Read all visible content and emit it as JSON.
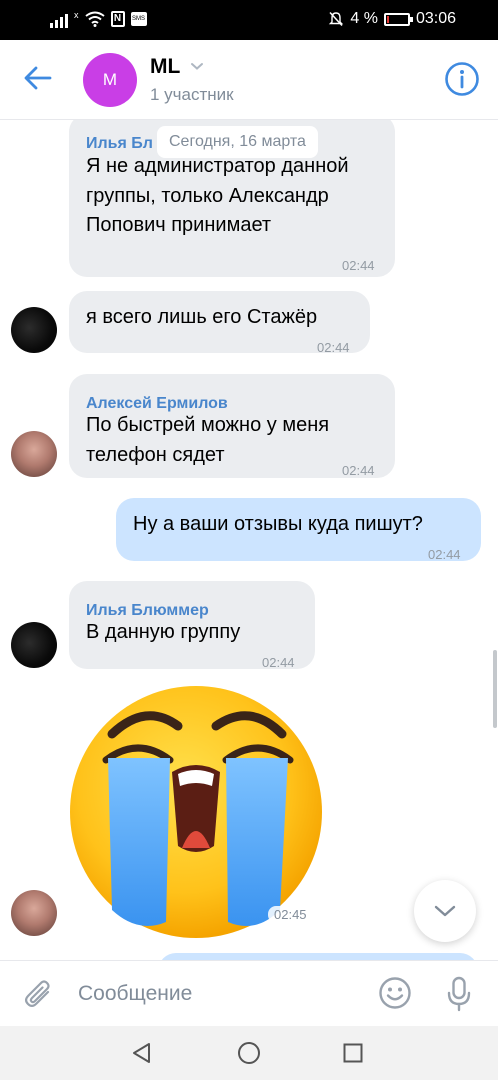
{
  "status_bar": {
    "signal_mark": "x",
    "nfc_label": "N",
    "sms_label": "SMS",
    "battery_percent": "4 %",
    "time": "03:06"
  },
  "header": {
    "avatar_letter": "M",
    "avatar_color": "#c93ee6",
    "title": "ML",
    "subtitle": "1 участник"
  },
  "chat": {
    "date_separator": "Сегодня, 16 марта",
    "messages": [
      {
        "sender": "Илья Бл",
        "text": "Я не администратор данной группы, только Александр Попович принимает",
        "time": "02:44",
        "outgoing": false
      },
      {
        "sender": "",
        "text": "я всего лишь его Стажёр",
        "time": "02:44",
        "outgoing": false
      },
      {
        "sender": "Алексей Ермилов",
        "text": "По быстрей можно у меня телефон сядет",
        "time": "02:44",
        "outgoing": false
      },
      {
        "sender": "",
        "text": "Ну а ваши отзывы куда пишут?",
        "time": "02:44",
        "outgoing": true
      },
      {
        "sender": "Илья Блюммер",
        "text": "В данную группу",
        "time": "02:44",
        "outgoing": false
      },
      {
        "sender": "",
        "sticker": "crying-face-sticker",
        "time": "02:45",
        "outgoing": false
      }
    ]
  },
  "input": {
    "placeholder": "Сообщение"
  },
  "colors": {
    "accent": "#3f8ae0",
    "incoming_bubble": "#ebedf0",
    "outgoing_bubble": "#cce4ff",
    "sender_name": "#4986cc"
  },
  "icons": {
    "back": "arrow-left-icon",
    "info": "info-icon",
    "attach": "paperclip-icon",
    "emoji": "smile-icon",
    "voice": "microphone-icon",
    "scroll_down": "chevron-down-icon"
  }
}
